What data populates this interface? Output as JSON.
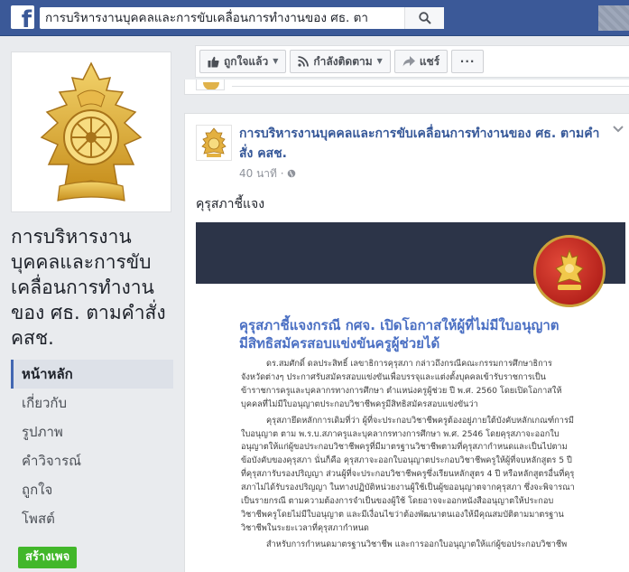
{
  "topbar": {
    "logo": "f",
    "search_value": "การบริหารงานบุคคลและการขับเคลื่อนการทำงานของ ศธ. ตา",
    "search_icon": "search-icon"
  },
  "page": {
    "name": "การบริหารงานบุคคลและการขับเคลื่อนการทำงานของ ศธ. ตามคำสั่ง คสช."
  },
  "nav": {
    "items": [
      {
        "label": "หน้าหลัก",
        "active": true
      },
      {
        "label": "เกี่ยวกับ"
      },
      {
        "label": "รูปภาพ"
      },
      {
        "label": "คำวิจารณ์"
      },
      {
        "label": "ถูกใจ"
      },
      {
        "label": "โพสต์"
      }
    ],
    "create_page": "สร้างเพจ"
  },
  "actions": {
    "liked": "ถูกใจแล้ว",
    "following": "กำลังติดตาม",
    "share": "แชร์",
    "more": "···"
  },
  "post": {
    "author": "การบริหารงานบุคคลและการขับเคลื่อนการทำงานของ ศธ. ตามคำสั่ง คสช.",
    "time": "40 นาที ·",
    "text": "คุรุสภาชี้แจง",
    "image": {
      "headline_1": "คุรุสภาชี้แจงกรณี กศจ. เปิดโอกาสให้ผู้ที่ไม่มีใบอนุญาต",
      "headline_2": "มีสิทธิสมัครสอบแข่งขันครูผู้ช่วยได้",
      "paragraphs": [
        "ดร.สมศักดิ์ ดลประสิทธิ์ เลขาธิการคุรุสภา กล่าวถึงกรณีคณะกรรมการศึกษาธิการจังหวัดต่างๆ ประกาศรับสมัครสอบแข่งขันเพื่อบรรจุและแต่งตั้งบุคคลเข้ารับราชการเป็นข้าราชการครูและบุคลากรทางการศึกษา ตำแหน่งครูผู้ช่วย ปี พ.ศ. 2560 โดยเปิดโอกาสให้บุคคลที่ไม่มีใบอนุญาตประกอบวิชาชีพครูมีสิทธิสมัครสอบแข่งขันว่า",
        "คุรุสภายึดหลักการเดิมที่ว่า ผู้ที่จะประกอบวิชาชีพครูต้องอยู่ภายใต้บังคับหลักเกณฑ์การมีใบอนุญาต ตาม พ.ร.บ.สภาครูและบุคลากรทางการศึกษา พ.ศ. 2546 โดยคุรุสภาจะออกใบอนุญาตให้แก่ผู้ขอประกอบวิชาชีพครูที่มีมาตรฐานวิชาชีพตามที่คุรุสภากำหนดและเป็นไปตามข้อบังคับของคุรุสภา นั่นก็คือ คุรุสภาจะออกใบอนุญาตประกอบวิชาชีพครูให้ผู้ที่จบหลักสูตร 5 ปี ที่คุรุสภารับรองปริญญา ส่วนผู้ที่จะประกอบวิชาชีพครูซึ่งเรียนหลักสูตร 4 ปี หรือหลักสูตรอื่นที่คุรุสภาไม่ได้รับรองปริญญา ในทางปฏิบัติหน่วยงานผู้ใช้เป็นผู้ขออนุญาตจากคุรุสภา ซึ่งจะพิจารณาเป็นรายกรณี ตามความต้องการจำเป็นของผู้ใช้ โดยอาจจะออกหนังสืออนุญาตให้ประกอบวิชาชีพครูโดยไม่มีใบอนุญาต และมีเงื่อนไขว่าต้องพัฒนาตนเองให้มีคุณสมบัติตามมาตรฐานวิชาชีพในระยะเวลาที่คุรุสภากำหนด",
        "สำหรับการกำหนดมาตรฐานวิชาชีพ และการออกใบอนุญาตให้แก่ผู้ขอประกอบวิชาชีพ"
      ]
    }
  },
  "colors": {
    "topbar": "#3b5998",
    "link": "#365899",
    "create_button": "#42b72a",
    "headline": "#4a6fc3"
  }
}
